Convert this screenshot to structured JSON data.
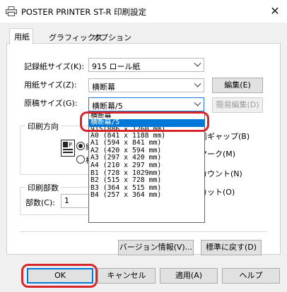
{
  "window": {
    "title": "POSTER PRINTER ST-R 印刷設定",
    "close_glyph": "✕"
  },
  "tabs": [
    {
      "label": "用紙",
      "active": true
    },
    {
      "label": "グラフィックス"
    },
    {
      "label": "オプション"
    }
  ],
  "fields": {
    "record_size_label": "記録紙サイズ(K):",
    "record_size_value": "915 ロール紙",
    "paper_size_label": "用紙サイズ(Z):",
    "paper_size_value": "横断幕",
    "original_size_label": "原稿サイズ(G):",
    "original_size_value": "横断幕/5"
  },
  "buttons": {
    "edit": "編集(E)",
    "simple_edit": "簡易編集(D)",
    "version_info": "バージョン情報(V)...",
    "restore_default": "標準に戻す(D)",
    "ok": "OK",
    "cancel": "キャンセル",
    "apply": "適用(A)",
    "help": "ヘルプ"
  },
  "print_direction": {
    "title": "印刷方向",
    "radio_labels": [
      "縦",
      "横"
    ],
    "selected": 0
  },
  "copies": {
    "title": "印刷部数",
    "label": "部数(C):",
    "value": "1"
  },
  "right_side": {
    "gap_label": "前ギャップ(B)",
    "mark_label": "マーク(M)",
    "count_label": "カウント(N)",
    "cut_label": "カット(O)"
  },
  "dropdown_options": [
    {
      "label": "横断幕",
      "state": "partial"
    },
    {
      "label": "横断幕/5",
      "state": "selected"
    },
    {
      "label": "915(886 × 1260 mm)",
      "state": "partial"
    },
    {
      "label": "A0 (841 x 1188 mm)"
    },
    {
      "label": "A1 (594 x 841 mm)"
    },
    {
      "label": "A2 (420 x 594 mm)"
    },
    {
      "label": "A3 (297 x 420 mm)"
    },
    {
      "label": "A4 (210 x 297 mm)"
    },
    {
      "label": "B1 (728 x 1029mm)"
    },
    {
      "label": "B2 (515 x 728 mm)"
    },
    {
      "label": "B3 (364 x 515 mm)"
    },
    {
      "label": "B4 (257 x 364 mm)"
    }
  ],
  "colors": {
    "accent": "#0078d7",
    "highlight_annotation": "#d7262a"
  }
}
